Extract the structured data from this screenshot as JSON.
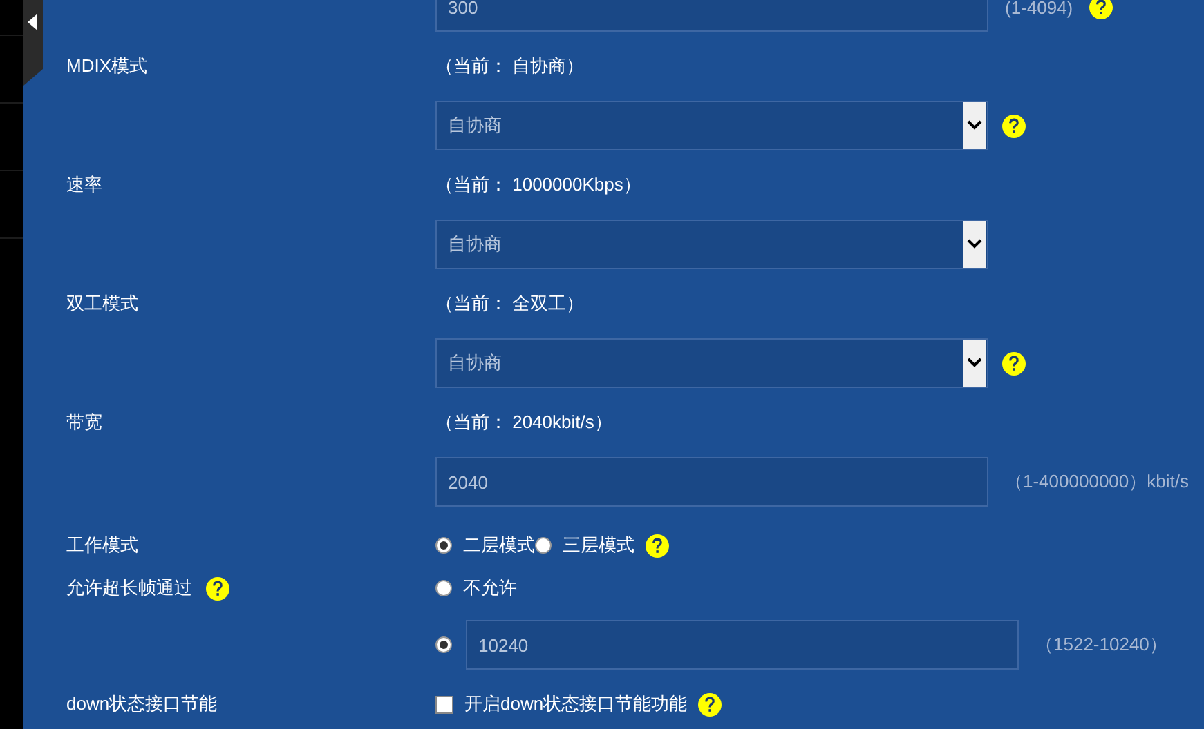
{
  "rows": [
    {
      "kind": "input",
      "value": "300",
      "hint": "(1-4094)",
      "help": true
    },
    {
      "kind": "status",
      "label": "MDIX模式",
      "current": "（当前： 自协商）"
    },
    {
      "kind": "select",
      "value": "自协商",
      "help": true
    },
    {
      "kind": "status",
      "label": "速率",
      "current": "（当前： 1000000Kbps）"
    },
    {
      "kind": "select",
      "value": "自协商",
      "help": false
    },
    {
      "kind": "status",
      "label": "双工模式",
      "current": "（当前： 全双工）"
    },
    {
      "kind": "select",
      "value": "自协商",
      "help": true
    },
    {
      "kind": "status",
      "label": "带宽",
      "current": "（当前： 2040kbit/s）"
    },
    {
      "kind": "input",
      "value": "2040",
      "hint": "（1-400000000）kbit/s",
      "help": false
    },
    {
      "kind": "radios",
      "label": "工作模式",
      "options": [
        {
          "label": "二层模式",
          "selected": true
        },
        {
          "label": "三层模式",
          "selected": false
        }
      ],
      "help": true
    },
    {
      "kind": "radio",
      "label": "允许超长帧通过",
      "label_help": true,
      "option": {
        "label": "不允许",
        "selected": false
      }
    },
    {
      "kind": "radio_input",
      "option": {
        "selected": true
      },
      "value": "10240",
      "hint": "（1522-10240）"
    },
    {
      "kind": "checkbox",
      "label": "down状态接口节能",
      "text": "开启down状态接口节能功能",
      "checked": false,
      "help": true
    }
  ]
}
